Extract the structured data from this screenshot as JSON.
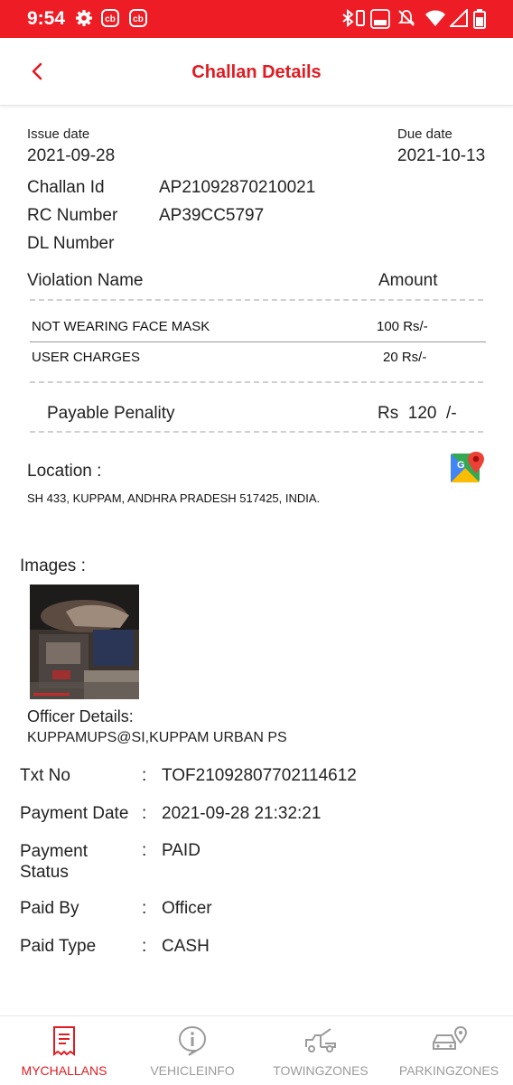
{
  "status_bar": {
    "time": "9:54",
    "cb1": "cb",
    "cb2": "cb"
  },
  "header": {
    "title": "Challan Details"
  },
  "details": {
    "issue_date_label": "Issue date",
    "issue_date": "2021-09-28",
    "due_date_label": "Due date",
    "due_date": "2021-10-13",
    "challan_id_label": "Challan Id",
    "challan_id": "AP21092870210021",
    "rc_number_label": "RC Number",
    "rc_number": "AP39CC5797",
    "dl_number_label": "DL Number"
  },
  "violations": {
    "col_name": "Violation Name",
    "col_amount": "Amount",
    "rows": [
      {
        "name": "NOT WEARING FACE MASK",
        "amount": "100 Rs/-"
      },
      {
        "name": "USER CHARGES",
        "amount": "20 Rs/-"
      }
    ],
    "payable_label": "Payable Penality",
    "payable_amount": "Rs  120  /-"
  },
  "location": {
    "label": "Location :",
    "address": "SH 433, KUPPAM, ANDHRA PRADESH 517425, INDIA.",
    "map_icon": "google-maps-icon"
  },
  "images": {
    "label": "Images :"
  },
  "officer": {
    "label": "Officer Details:",
    "value": "KUPPAMUPS@SI,KUPPAM URBAN PS"
  },
  "payment": [
    {
      "label": "Txt No",
      "colon": ":",
      "value": "TOF21092807702114612"
    },
    {
      "label": "Payment Date",
      "colon": ":",
      "value": "2021-09-28 21:32:21"
    },
    {
      "label": "Payment\nStatus",
      "colon": ":",
      "value": "PAID"
    },
    {
      "label": "Paid By",
      "colon": ":",
      "value": "Officer"
    },
    {
      "label": "Paid Type",
      "colon": ":",
      "value": "CASH"
    }
  ],
  "bottom_nav": [
    {
      "label": "MYCHALLANS",
      "icon": "receipt-icon",
      "active": true
    },
    {
      "label": "VEHICLEINFO",
      "icon": "info-icon",
      "active": false
    },
    {
      "label": "TOWINGZONES",
      "icon": "tow-truck-icon",
      "active": false
    },
    {
      "label": "PARKINGZONES",
      "icon": "parking-car-icon",
      "active": false
    }
  ],
  "colors": {
    "accent": "#ee1c25",
    "title_red": "#e11b22",
    "inactive": "#9b9b9b"
  }
}
